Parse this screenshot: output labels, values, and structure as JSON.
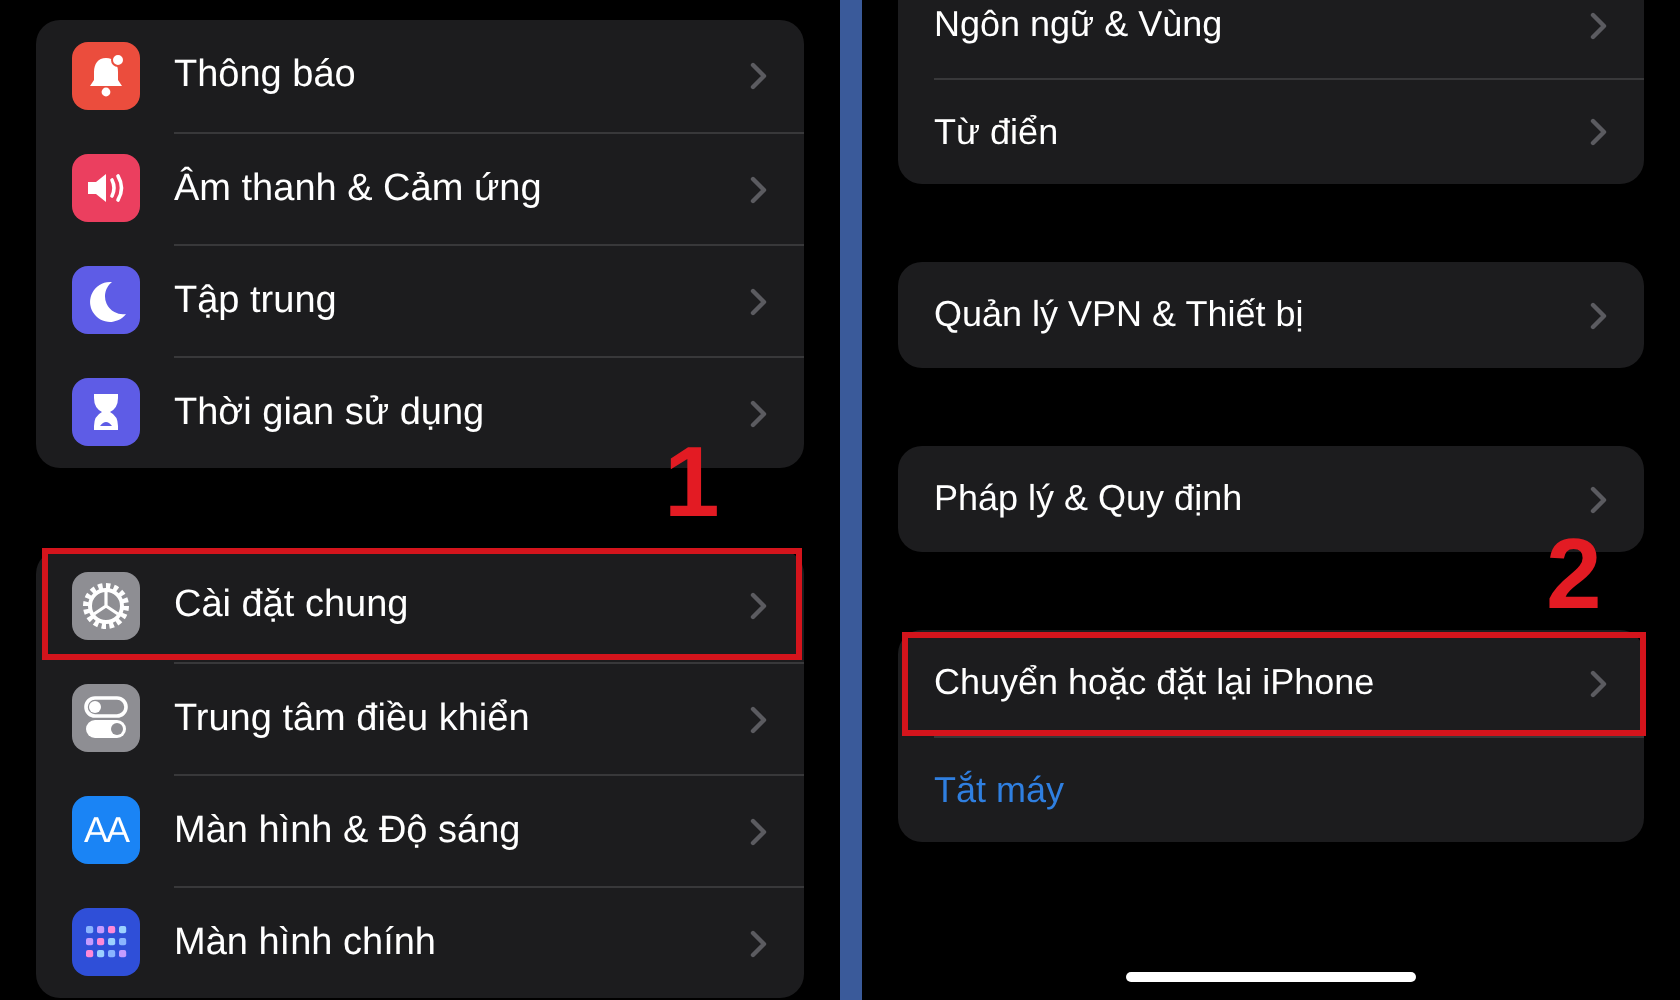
{
  "left_panel": {
    "step_number": "1",
    "groups": [
      {
        "rows": [
          {
            "label": "Thông báo",
            "color": "#eb4d3d",
            "highlighted": false
          },
          {
            "label": "Âm thanh & Cảm ứng",
            "color": "#eb3f5f",
            "highlighted": false
          },
          {
            "label": "Tập trung",
            "color": "#5e5ce6",
            "highlighted": false
          },
          {
            "label": "Thời gian sử dụng",
            "color": "#5e5ce6",
            "highlighted": false
          }
        ]
      },
      {
        "rows": [
          {
            "label": "Cài đặt chung",
            "color": "#8e8e93",
            "highlighted": true
          },
          {
            "label": "Trung tâm điều khiển",
            "color": "#8e8e93",
            "highlighted": false
          },
          {
            "label": "Màn hình & Độ sáng",
            "icon_text": "AA",
            "color": "#1a84f5",
            "highlighted": false
          },
          {
            "label": "Màn hình chính",
            "color": "#2f4fd8",
            "highlighted": false
          }
        ]
      }
    ]
  },
  "right_panel": {
    "step_number": "2",
    "groups": [
      {
        "rows": [
          {
            "label": "Ngôn ngữ & Vùng",
            "kind": "nav",
            "highlighted": false
          },
          {
            "label": "Từ điển",
            "kind": "nav",
            "highlighted": false
          }
        ]
      },
      {
        "rows": [
          {
            "label": "Quản lý VPN & Thiết bị",
            "kind": "nav",
            "highlighted": false
          }
        ]
      },
      {
        "rows": [
          {
            "label": "Pháp lý & Quy định",
            "kind": "nav",
            "highlighted": false
          }
        ]
      },
      {
        "rows": [
          {
            "label": "Chuyển hoặc đặt lại iPhone",
            "kind": "nav",
            "highlighted": true
          },
          {
            "label": "Tắt máy",
            "kind": "link",
            "highlighted": false
          }
        ]
      }
    ]
  }
}
